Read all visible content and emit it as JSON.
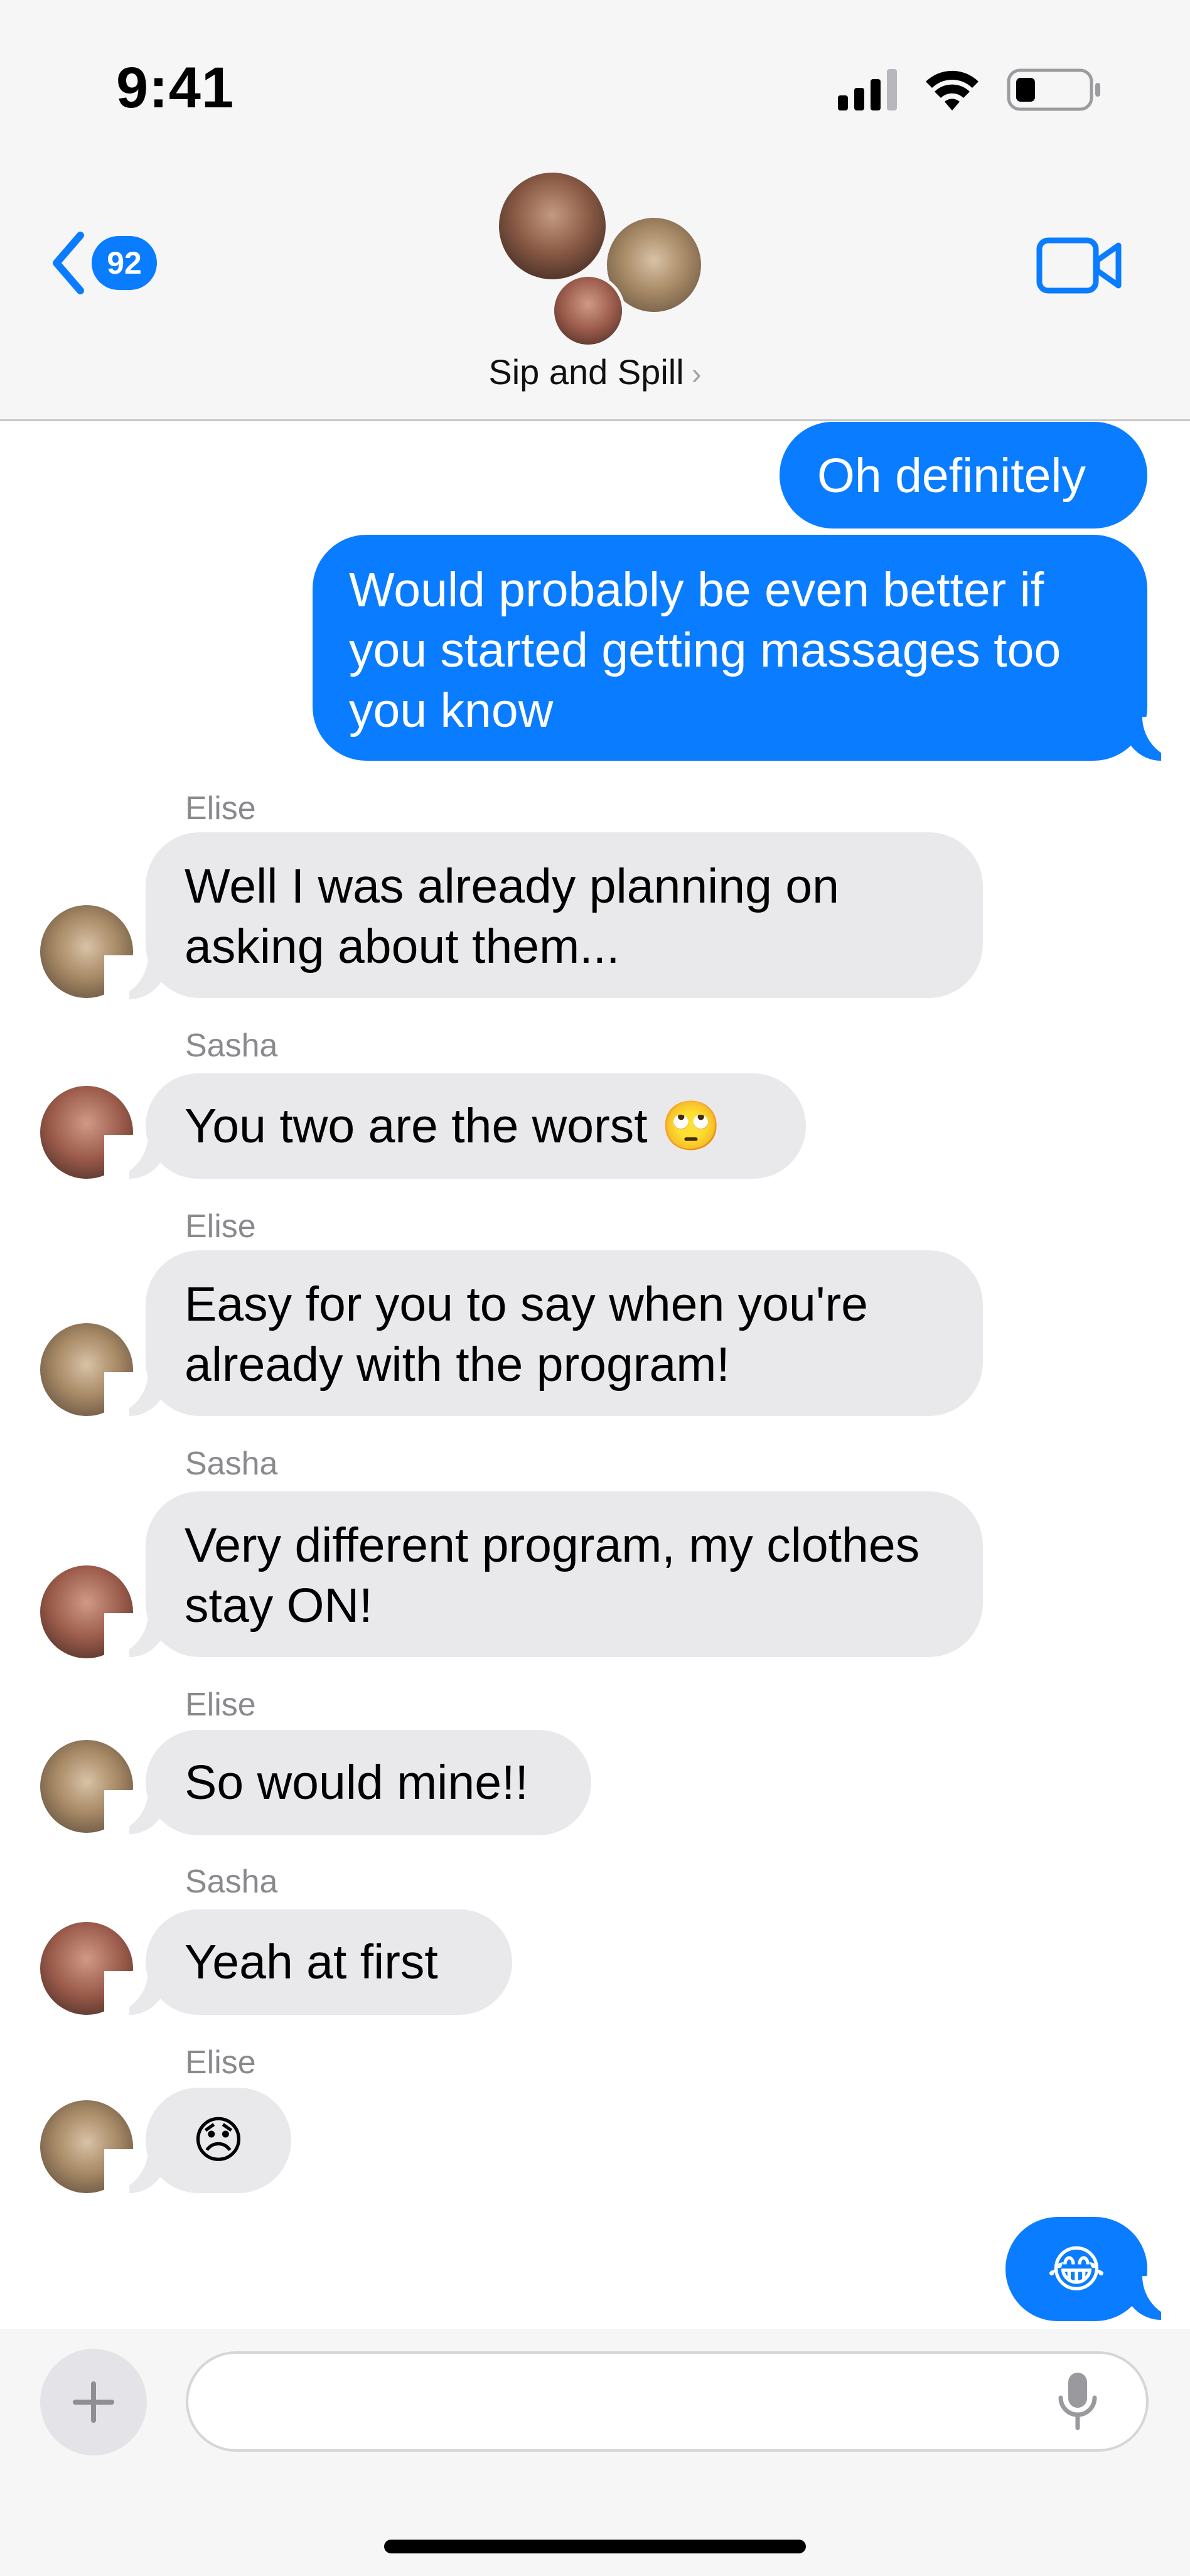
{
  "status": {
    "time": "9:41"
  },
  "header": {
    "back_badge": "92",
    "group_name": "Sip and Spill",
    "chevron": "›"
  },
  "messages": [
    {
      "id": "m1",
      "direction": "outgoing",
      "text": "Oh definitely"
    },
    {
      "id": "m2",
      "direction": "outgoing",
      "text": "Would probably be even better if you started getting massages too you know"
    },
    {
      "id": "m3",
      "direction": "incoming",
      "sender": "Elise",
      "text": "Well I was already planning on asking about them..."
    },
    {
      "id": "m4",
      "direction": "incoming",
      "sender": "Sasha",
      "text": "You two are the worst 🙄"
    },
    {
      "id": "m5",
      "direction": "incoming",
      "sender": "Elise",
      "text": "Easy for you to say when you're already with the program!"
    },
    {
      "id": "m6",
      "direction": "incoming",
      "sender": "Sasha",
      "text": "Very different program, my clothes stay ON!"
    },
    {
      "id": "m7",
      "direction": "incoming",
      "sender": "Elise",
      "text": "So would mine!!"
    },
    {
      "id": "m8",
      "direction": "incoming",
      "sender": "Sasha",
      "text": "Yeah at first"
    },
    {
      "id": "m9",
      "direction": "incoming",
      "sender": "Elise",
      "text": "😞"
    },
    {
      "id": "m10",
      "direction": "outgoing",
      "text": "😂"
    }
  ],
  "composer": {
    "placeholder": "",
    "value": ""
  },
  "icons": {
    "back": "chevron-left-icon",
    "video": "video-camera-icon",
    "plus": "plus-icon",
    "mic": "microphone-icon"
  },
  "colors": {
    "accent": "#0a7cff",
    "incoming_bubble": "#e9e9eb",
    "header_bg": "#f6f6f7"
  }
}
